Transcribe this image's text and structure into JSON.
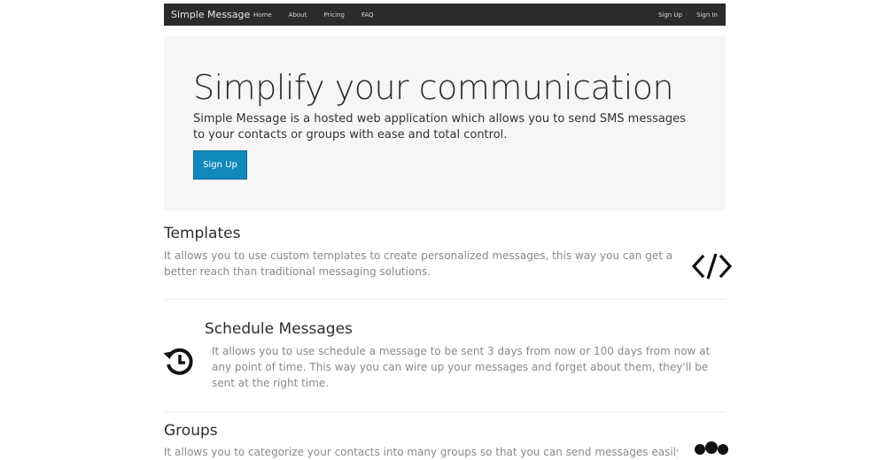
{
  "navbar": {
    "brand": "Simple Message",
    "links": [
      "Home",
      "About",
      "Pricing",
      "FAQ"
    ],
    "right_links": [
      "Sign Up",
      "Sign In"
    ]
  },
  "hero": {
    "title": "Simplify your communication",
    "description": "Simple Message is a hosted web application which allows you to send SMS messages to your contacts or groups with ease and total control.",
    "button_label": "Sign Up",
    "button_color": "#1188bb"
  },
  "features": [
    {
      "title": "Templates",
      "description": "It allows you to use custom templates to create personalized messages, this way you can get a better reach than traditional messaging solutions.",
      "icon": "code-icon"
    },
    {
      "title": "Schedule Messages",
      "description": "It allows you to use schedule a message to be sent 3 days from now or 100 days from now at any point of time. This way you can wire up your messages and forget about them, they'll be sent at the right time.",
      "icon": "history-icon"
    },
    {
      "title": "Groups",
      "description": "It allows you to categorize your contacts into many groups so that you can send messages easily. You",
      "icon": "group-icon"
    }
  ]
}
